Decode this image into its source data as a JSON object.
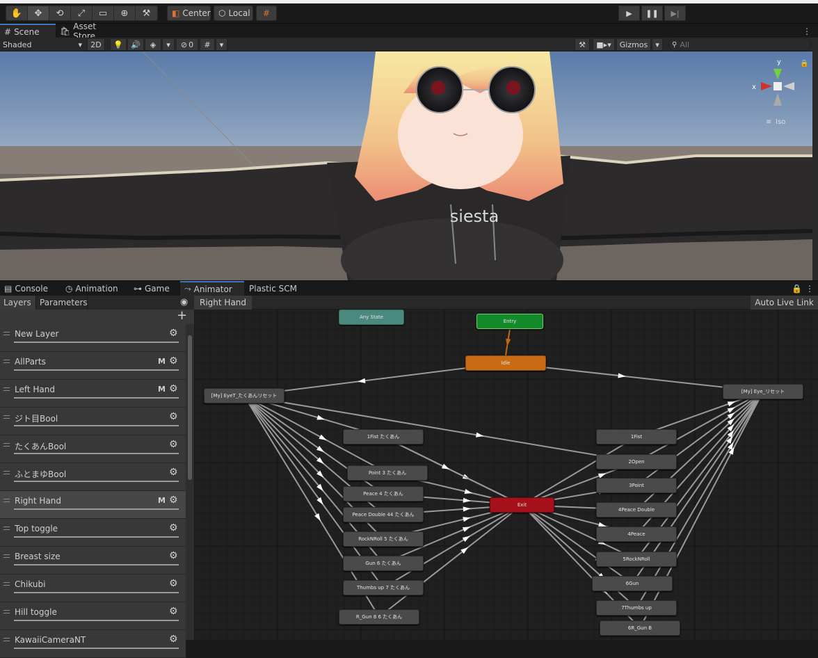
{
  "toolbar": {
    "pivot_center": "Center",
    "pivot_local": "Local"
  },
  "scene_tabs": {
    "scene": "Scene",
    "asset_store": "Asset Store"
  },
  "scene_bar": {
    "shading": "Shaded",
    "mode_2d": "2D",
    "hidden_count": "0",
    "gizmos": "Gizmos",
    "search_placeholder": "All"
  },
  "gizmo": {
    "x_label": "x",
    "y_label": "y",
    "iso_label": "Iso"
  },
  "scene_view": {
    "shirt_text": "siesta"
  },
  "bottom_tabs": {
    "console": "Console",
    "animation": "Animation",
    "game": "Game",
    "animator": "Animator",
    "plastic": "Plastic SCM"
  },
  "animator": {
    "layers_tab": "Layers",
    "parameters_tab": "Parameters",
    "breadcrumb": "Right Hand",
    "auto_live_link": "Auto Live Link",
    "layers": [
      {
        "name": "New Layer",
        "badge": ""
      },
      {
        "name": "AllParts",
        "badge": "M"
      },
      {
        "name": "Left Hand",
        "badge": "M"
      },
      {
        "name": "ジト目Bool",
        "badge": ""
      },
      {
        "name": "たくあんBool",
        "badge": ""
      },
      {
        "name": "ふとまゆBool",
        "badge": ""
      },
      {
        "name": "Right Hand",
        "badge": "M"
      },
      {
        "name": "Top toggle",
        "badge": ""
      },
      {
        "name": "Breast size",
        "badge": ""
      },
      {
        "name": "Chikubi",
        "badge": ""
      },
      {
        "name": "Hill toggle",
        "badge": ""
      },
      {
        "name": "KawaiiCameraNT",
        "badge": ""
      }
    ],
    "states": {
      "any_state": "Any State",
      "entry": "Entry",
      "idle": "Idle",
      "exit": "Exit",
      "left_reset": "[My] EyeT_たくあんリセット",
      "right_reset": "[My] Eye_リセット",
      "left_states": [
        "1Fist たくあん",
        "Point 3 たくあん",
        "Peace 4 たくあん",
        "Peace Double 44 たくあん",
        "RockNRoll 5 たくあん",
        "Gun 6 たくあん",
        "Thumbs up 7 たくあん",
        "R_Gun 8 6 たくあん"
      ],
      "right_states": [
        "1Fist",
        "2Open",
        "3Point",
        "4Peace Double",
        "4Peace",
        "5RockNRoll",
        "6Gun",
        "7Thumbs up",
        "6R_Gun B"
      ]
    }
  }
}
